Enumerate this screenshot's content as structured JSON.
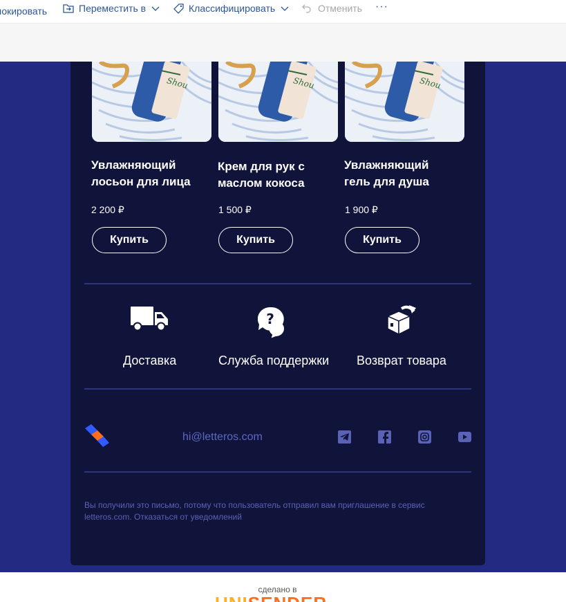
{
  "toolbar": {
    "block_label": "локировать",
    "move_label": "Переместить в",
    "classify_label": "Классифицировать",
    "undo_label": "Отменить",
    "more_label": "···"
  },
  "products": [
    {
      "title": "Увлажняющий лосьон для лица",
      "price": "2 200 ₽",
      "button": "Купить"
    },
    {
      "title": "Крем для рук с маслом кокоса",
      "price": "1 500 ₽",
      "button": "Купить"
    },
    {
      "title": "Увлажняющий гель для душа",
      "price": "1 900 ₽",
      "button": "Купить"
    }
  ],
  "product_image_text": "Shou",
  "services": [
    {
      "label": "Доставка",
      "icon": "truck-icon"
    },
    {
      "label": "Служба поддержки",
      "icon": "support-chat-icon"
    },
    {
      "label": "Возврат товара",
      "icon": "return-box-icon"
    }
  ],
  "footer": {
    "email": "hi@letteros.com",
    "social": [
      "telegram-icon",
      "facebook-icon",
      "instagram-icon",
      "youtube-icon"
    ],
    "disclaimer": "Вы получили это письмо, потому что пользователь отправил вам приглашение в сервис letteros.com. Отказаться от уведомлений"
  },
  "branding": {
    "made_in": "сделано в",
    "unisender": "UNISENDER"
  },
  "colors": {
    "outer_bg": "#232a82",
    "card_bg": "#10133a",
    "accent_link": "#2b579a",
    "muted_text": "#5a62b5",
    "unisender_orange": "#ff6d21"
  }
}
